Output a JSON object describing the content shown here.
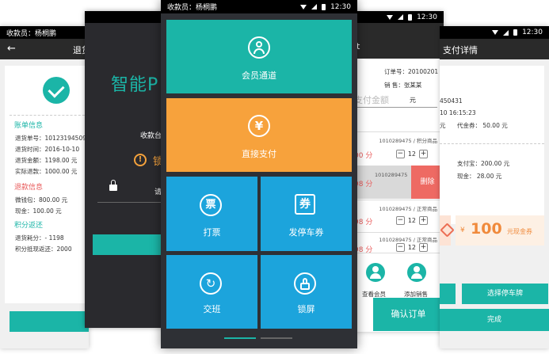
{
  "refund_screen": {
    "status_user": "收款员：杨桐鹏",
    "title": "退货",
    "bill_section": "账单信息",
    "refund_section": "退款信息",
    "points_section": "积分返还",
    "rows": [
      "退货单号：10123194509",
      "退货时间：2016-10-10",
      "退货金额：1198.00 元",
      "实际退款：1000.00 元"
    ],
    "refund_rows": [
      "微钱包：800.00 元",
      "现金：100.00 元"
    ],
    "points_rows": [
      "退货耗分：- 1198",
      "积分抵现返还：2000"
    ]
  },
  "login_screen": {
    "brand": "智能P",
    "cashier": "收款台",
    "warning": "锁",
    "lock_field": "请"
  },
  "menu_screen": {
    "status_user": "收款员：杨桐鹏",
    "time": "12:30",
    "tiles": {
      "member": "会员通道",
      "direct_pay": "直接支付",
      "print": "打票",
      "parking": "发停车券",
      "shift": "交班",
      "lock": "锁屏"
    },
    "print_glyph": "票",
    "parking_glyph": "券",
    "yen_glyph": "¥",
    "refresh_glyph": "↻"
  },
  "order_screen": {
    "time": "12:30",
    "title": "t",
    "order_no": "订单号：20100201",
    "sales": "销 售：张某某",
    "amount_placeholder": "支付金额",
    "yuan": "元",
    "items": [
      {
        "code": "1010289475 / 积分商品",
        "price": "00 分",
        "qty": "12"
      },
      {
        "code": "1010289475 / 正常商品",
        "price": "98 分",
        "qty": "12"
      },
      {
        "code": "1010289475 / 正常商品",
        "price": "98 分",
        "qty": "12"
      }
    ],
    "swipe_code": "1010289475",
    "swipe_price": "98 分",
    "delete": "删除",
    "view_member": "查看会员",
    "add_sales": "添加销售",
    "confirm": "确认订单",
    "minus": "−",
    "plus": "+"
  },
  "payment_detail_screen": {
    "time": "12:30",
    "title": "支付详情",
    "rows": [
      "450431",
      "10 16:15:23",
      "代金券：    50.00  元",
      "支付宝：200.00 元",
      "现金：    28.00 元"
    ],
    "row_left_1": "元",
    "coupon_currency": "¥",
    "coupon_amount": "100",
    "coupon_text": "元现金券",
    "select_parking": "选择停车牌",
    "done": "完成"
  }
}
